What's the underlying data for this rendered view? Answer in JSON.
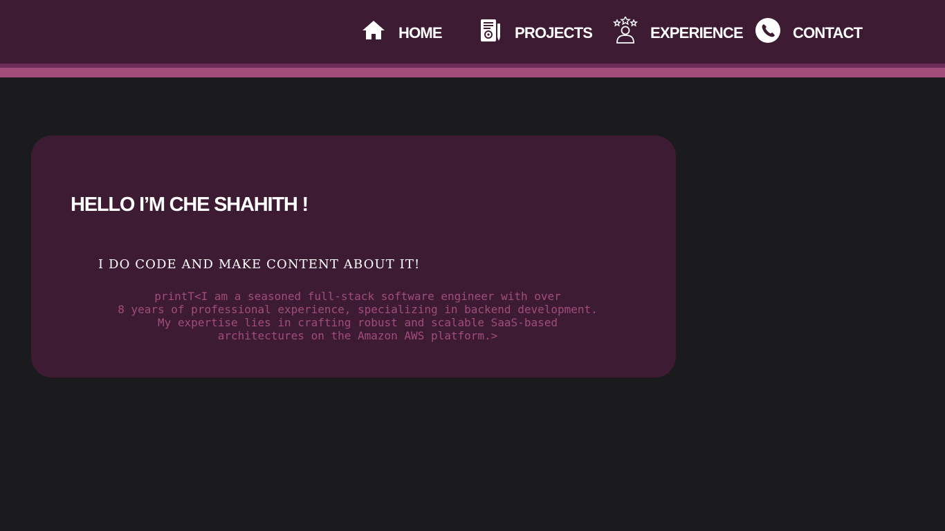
{
  "nav": {
    "items": [
      {
        "label": "HOME",
        "icon": "home-icon"
      },
      {
        "label": "PROJECTS",
        "icon": "document-gear-icon"
      },
      {
        "label": "EXPERIENCE",
        "icon": "user-stars-icon"
      },
      {
        "label": "CONTACT",
        "icon": "phone-icon"
      }
    ]
  },
  "hero": {
    "title": "HELLO  I’M  CHE SHAHITH  !",
    "tagline": "I DO CODE AND MAKE CONTENT ABOUT IT!",
    "bio": "printT<I am a seasoned full-stack software engineer with over\n8 years of professional experience, specializing in backend development.\nMy expertise lies in crafting robust and scalable SaaS-based\narchitectures on the Amazon AWS platform.>"
  },
  "colors": {
    "background": "#1b1b1d",
    "header": "#3d1c33",
    "card": "#3d1c33",
    "accent": "#a14c7b",
    "accent_dark": "#6e2c5a",
    "text": "#ffffff"
  }
}
